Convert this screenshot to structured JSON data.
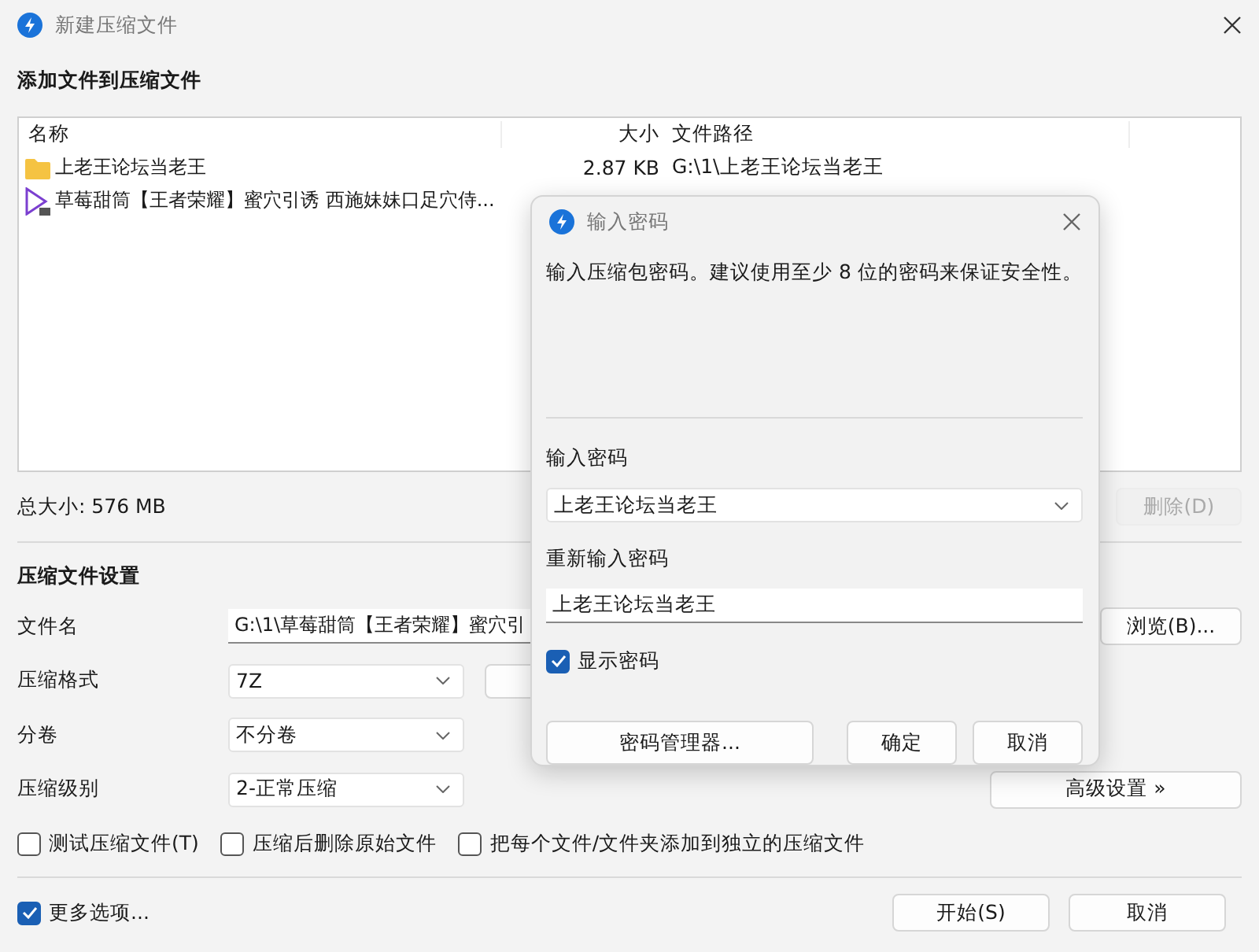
{
  "window": {
    "title": "新建压缩文件"
  },
  "add_section": {
    "heading": "添加文件到压缩文件"
  },
  "file_list": {
    "columns": [
      "名称",
      "大小",
      "文件路径"
    ],
    "rows": [
      {
        "kind": "folder",
        "name": "上老王论坛当老王",
        "size": "2.87 KB",
        "path": "G:\\1\\上老王论坛当老王"
      },
      {
        "kind": "video",
        "name": "草莓甜筒【王者荣耀】蜜穴引诱 西施妹妹口足穴侍..."
      }
    ]
  },
  "total_size": "总大小: 576 MB",
  "delete_button": {
    "label": "删除(D)",
    "disabled": true
  },
  "settings": {
    "heading": "压缩文件设置",
    "filename": {
      "label": "文件名",
      "value": "G:\\1\\草莓甜筒【王者荣耀】蜜穴引"
    },
    "browse_button": "浏览(B)...",
    "format": {
      "label": "压缩格式",
      "value": "7Z"
    },
    "split": {
      "label": "分卷",
      "value": "不分卷"
    },
    "level": {
      "label": "压缩级别",
      "value": "2-正常压缩"
    },
    "advanced_button": "高级设置 »",
    "options": [
      {
        "label": "测试压缩文件(T)",
        "checked": false
      },
      {
        "label": "压缩后删除原始文件",
        "checked": false
      },
      {
        "label": "把每个文件/文件夹添加到独立的压缩文件",
        "checked": false
      }
    ]
  },
  "more_options": {
    "label": "更多选项...",
    "checked": true
  },
  "buttons": [
    "开始(S)",
    "取消"
  ],
  "password_dialog": {
    "title": "输入密码",
    "message": "输入压缩包密码。建议使用至少 8 位的密码来保证安全性。",
    "password_label": "输入密码",
    "password_value": "上老王论坛当老王",
    "reenter_label": "重新输入密码",
    "reenter_value": "上老王论坛当老王",
    "show_password": {
      "label": "显示密码",
      "checked": true
    },
    "manager_button": "密码管理器...",
    "ok_button": "确定",
    "cancel_button": "取消"
  }
}
